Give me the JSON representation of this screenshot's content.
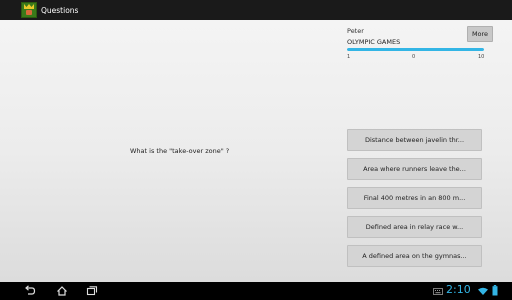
{
  "app": {
    "title": "Questions",
    "icon": "app-crown-icon"
  },
  "header": {
    "player_name": "Peter",
    "category": "OLYMPIC GAMES",
    "more_label": "More",
    "progress_fraction": 1.0,
    "scale": {
      "min": "1",
      "mid": "0",
      "max": "10"
    }
  },
  "question": {
    "text": "What is the \"take-over zone\" ?"
  },
  "answers": [
    {
      "label": "Distance between javelin thr..."
    },
    {
      "label": "Area where runners leave the..."
    },
    {
      "label": "Final 400 metres in an 800 m..."
    },
    {
      "label": "Defined area in relay race w..."
    },
    {
      "label": "A defined area on the gymnas..."
    }
  ],
  "system_bar": {
    "time": "2:10",
    "icons": [
      "back-icon",
      "home-icon",
      "recent-apps-icon",
      "keyboard-icon",
      "wifi-icon",
      "battery-icon"
    ]
  },
  "colors": {
    "accent": "#33b5e5",
    "action_bar": "#1a1a1a",
    "button": "#d4d4d4"
  }
}
